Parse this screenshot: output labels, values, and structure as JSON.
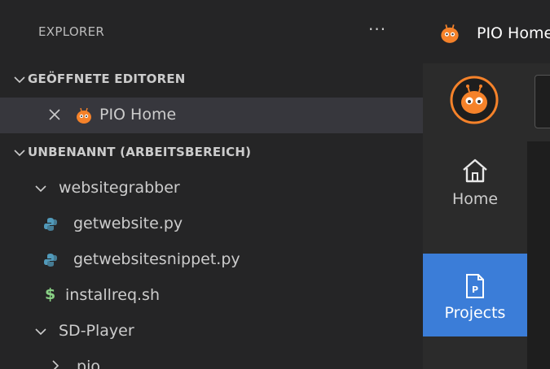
{
  "explorer": {
    "title": "EXPLORER",
    "more_label": "···",
    "open_editors": {
      "label": "GEÖFFNETE EDITOREN",
      "items": [
        {
          "label": "PIO Home"
        }
      ]
    },
    "workspace": {
      "label": "UNBENANNT (ARBEITSBEREICH)",
      "folders": [
        {
          "name": "websitegrabber",
          "files": [
            {
              "name": "getwebsite.py",
              "icon": "python-icon"
            },
            {
              "name": "getwebsitesnippet.py",
              "icon": "python-icon"
            },
            {
              "name": "installreq.sh",
              "icon": "shell-icon"
            }
          ]
        },
        {
          "name": "SD-Player",
          "subfolders": [
            {
              "name": ".pio"
            }
          ]
        }
      ]
    }
  },
  "editor_tab": {
    "label": "PIO Home"
  },
  "pio_nav": {
    "items": [
      {
        "label": "Home",
        "icon": "home-icon",
        "active": false
      },
      {
        "label": "Projects",
        "icon": "projects-icon",
        "active": true
      }
    ]
  },
  "colors": {
    "sidebar_bg": "#252526",
    "selected_row": "#37373d",
    "accent_blue": "#3b7dd8",
    "pio_orange": "#f5822a",
    "python_blue": "#519aba",
    "shell_green": "#89d185"
  }
}
